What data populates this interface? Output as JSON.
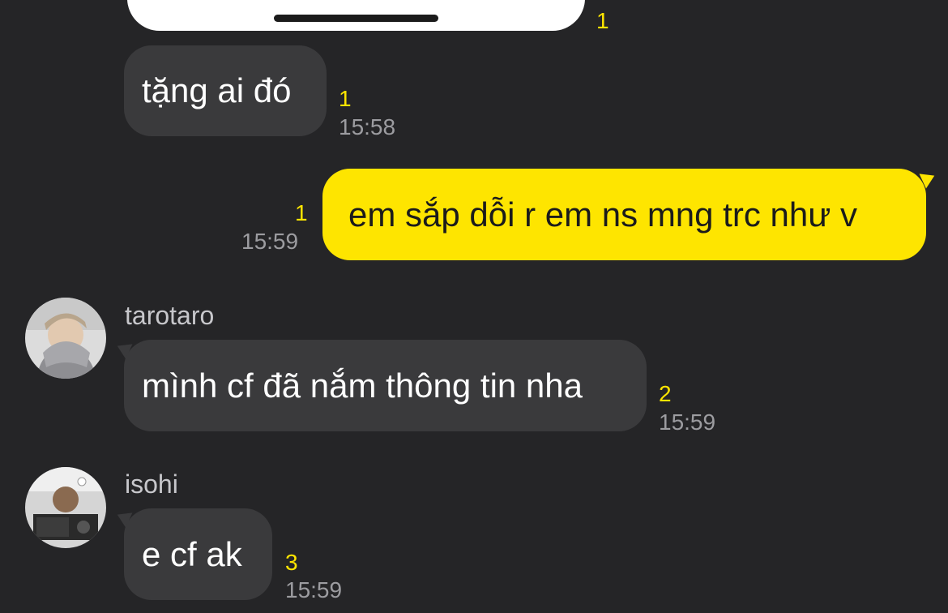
{
  "colors": {
    "background": "#252527",
    "incoming_bubble": "#3a3a3c",
    "outgoing_bubble": "#fee500",
    "unread_count": "#fee500",
    "timestamp": "#9c9ca0"
  },
  "top_card": {
    "unread": "1"
  },
  "messages": [
    {
      "text": "tặng ai đó",
      "unread": "1",
      "time": "15:58"
    },
    {
      "text": "em sắp dỗi r em ns mng trc như v",
      "unread": "1",
      "time": "15:59"
    },
    {
      "sender": "tarotaro",
      "avatar_icon": "user-avatar-photo",
      "text": "mình cf đã nắm thông tin nha",
      "unread": "2",
      "time": "15:59"
    },
    {
      "sender": "isohi",
      "avatar_icon": "user-avatar-photo",
      "text": "e cf ak",
      "unread": "3",
      "time": "15:59"
    }
  ]
}
